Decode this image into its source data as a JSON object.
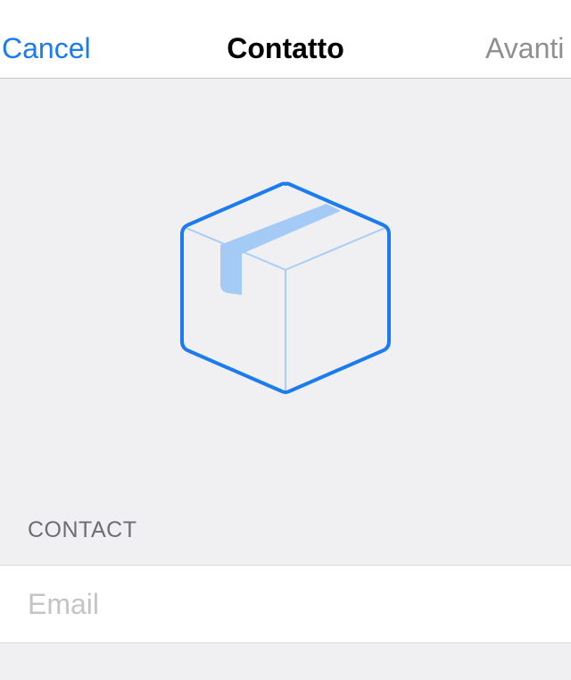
{
  "navbar": {
    "cancel_label": "Cancel",
    "title": "Contatto",
    "next_label": "Avanti"
  },
  "hero": {
    "icon": "package-box-icon",
    "accent_color": "#1a7cf0"
  },
  "contact_section": {
    "header": "CONTACT",
    "email_field": {
      "value": "",
      "placeholder": "Email"
    }
  }
}
